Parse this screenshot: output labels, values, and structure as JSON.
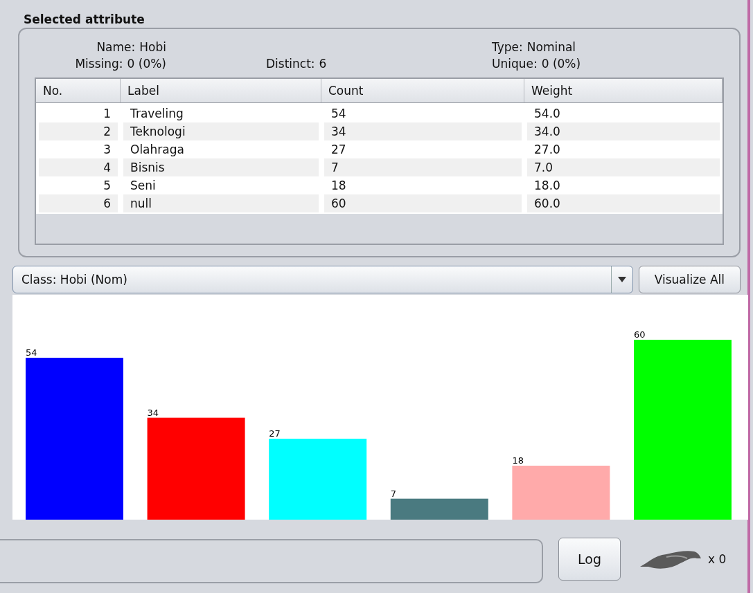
{
  "panel": {
    "title": "Selected attribute"
  },
  "stats": [
    {
      "label": "Name:",
      "value": "Hobi"
    },
    {
      "label": "Type:",
      "value": "Nominal"
    },
    {
      "label": "Missing:",
      "value": "0 (0%)"
    },
    {
      "label": "Distinct:",
      "value": "6"
    },
    {
      "label": "Unique:",
      "value": "0 (0%)"
    }
  ],
  "table": {
    "columns": [
      "No.",
      "Label",
      "Count",
      "Weight"
    ],
    "rows": [
      [
        "1",
        "Traveling",
        "54",
        "54.0"
      ],
      [
        "2",
        "Teknologi",
        "34",
        "34.0"
      ],
      [
        "3",
        "Olahraga",
        "27",
        "27.0"
      ],
      [
        "4",
        "Bisnis",
        "7",
        "7.0"
      ],
      [
        "5",
        "Seni",
        "18",
        "18.0"
      ],
      [
        "6",
        "null",
        "60",
        "60.0"
      ]
    ]
  },
  "class_select": {
    "value": "Class: Hobi (Nom)"
  },
  "visualize_button": "Visualize All",
  "chart_data": {
    "type": "bar",
    "data_labels": true,
    "values": [
      54,
      34,
      27,
      7,
      18,
      60
    ],
    "colors": [
      "#0000ff",
      "#ff0000",
      "#00ffff",
      "#4a7a80",
      "#ffaaaa",
      "#00ff00"
    ]
  },
  "log_button": "Log",
  "status_count": "x 0"
}
